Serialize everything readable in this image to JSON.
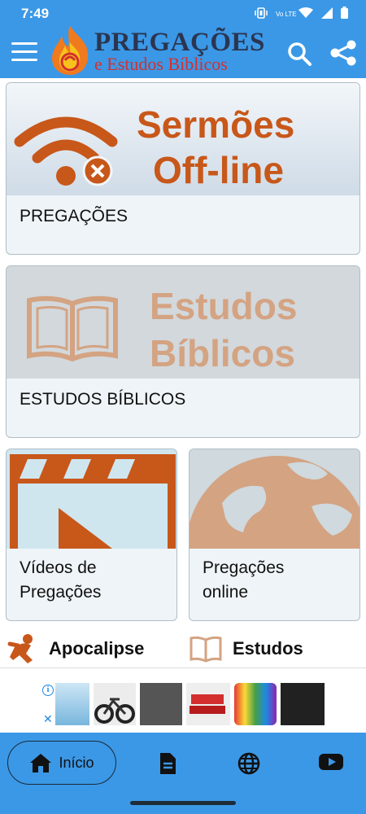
{
  "status_bar": {
    "time": "7:49",
    "network_label": "Vo LTE"
  },
  "app_bar": {
    "title": "PREGAÇÕES",
    "subtitle": "e Estudos Bíblicos"
  },
  "cards": [
    {
      "banner_line1": "Sermões",
      "banner_line2": "Off-line",
      "label": "PREGAÇÕES"
    },
    {
      "banner_line1": "Estudos",
      "banner_line2": "Bíblicos",
      "label": "ESTUDOS BÍBLICOS"
    },
    {
      "label_line1": "Vídeos de",
      "label_line2": "Pregações"
    },
    {
      "label_line1": "Pregações",
      "label_line2": "online"
    }
  ],
  "shortcuts": [
    {
      "label": "Apocalipse"
    },
    {
      "label": "Estudos"
    }
  ],
  "bottom_nav": {
    "home_label": "Início"
  },
  "colors": {
    "primary": "#3b98e6",
    "accent_orange": "#c8571a",
    "muted_orange": "#d4a382",
    "card_bg": "#eef4f7"
  },
  "icons": [
    "menu-icon",
    "search-icon",
    "share-icon",
    "wifi-off-icon",
    "book-icon",
    "video-clapper-icon",
    "globe-icon",
    "home-icon",
    "document-icon",
    "youtube-icon"
  ]
}
